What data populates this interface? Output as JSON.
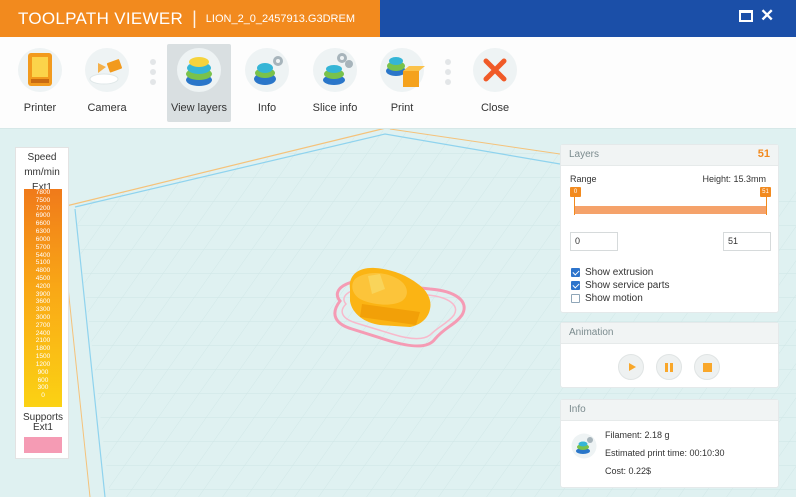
{
  "window": {
    "app_title": "TOOLPATH VIEWER",
    "separator": "|",
    "file_name": "LION_2_0_2457913.G3DREM",
    "close_glyph": "✕"
  },
  "toolbar": {
    "items": [
      {
        "label": "Printer",
        "icon": "printer-icon"
      },
      {
        "label": "Camera",
        "icon": "camera-icon"
      },
      {
        "label": "View layers",
        "icon": "layers-icon",
        "active": true
      },
      {
        "label": "Info",
        "icon": "info-gear-icon"
      },
      {
        "label": "Slice info",
        "icon": "slice-info-icon"
      },
      {
        "label": "Print",
        "icon": "print-icon"
      },
      {
        "label": "Close",
        "icon": "close-icon"
      }
    ]
  },
  "legend": {
    "title_line1": "Speed",
    "title_line2": "mm/min",
    "title_line3": "Ext1",
    "speeds": [
      "7800",
      "7500",
      "7200",
      "6900",
      "6600",
      "6300",
      "6000",
      "5700",
      "5400",
      "5100",
      "4800",
      "4500",
      "4200",
      "3900",
      "3600",
      "3300",
      "3000",
      "2700",
      "2400",
      "2100",
      "1800",
      "1500",
      "1200",
      "900",
      "600",
      "300",
      "0"
    ],
    "supports_line1": "Supports",
    "supports_line2": "Ext1",
    "supports_color": "#f59bb4"
  },
  "layers_panel": {
    "title": "Layers",
    "count": "51",
    "range_label": "Range",
    "height_label": "Height: 15.3mm",
    "min_thumb": "0",
    "max_thumb": "51",
    "min_value": "0",
    "max_value": "51",
    "show_extrusion": "Show extrusion",
    "show_service_parts": "Show service parts",
    "show_motion": "Show motion",
    "extrusion_checked": true,
    "service_parts_checked": true,
    "motion_checked": false
  },
  "animation_panel": {
    "title": "Animation"
  },
  "info_panel": {
    "title": "Info",
    "filament": "Filament: 2.18 g",
    "print_time": "Estimated print time: 00:10:30",
    "cost": "Cost: 0.22$"
  },
  "colors": {
    "title_orange": "#f28a1e",
    "title_blue": "#1b4fa8",
    "accent": "#f28a1e",
    "model": "#fbb414",
    "support": "#f59bb4",
    "checkbox": "#2d74cc"
  }
}
